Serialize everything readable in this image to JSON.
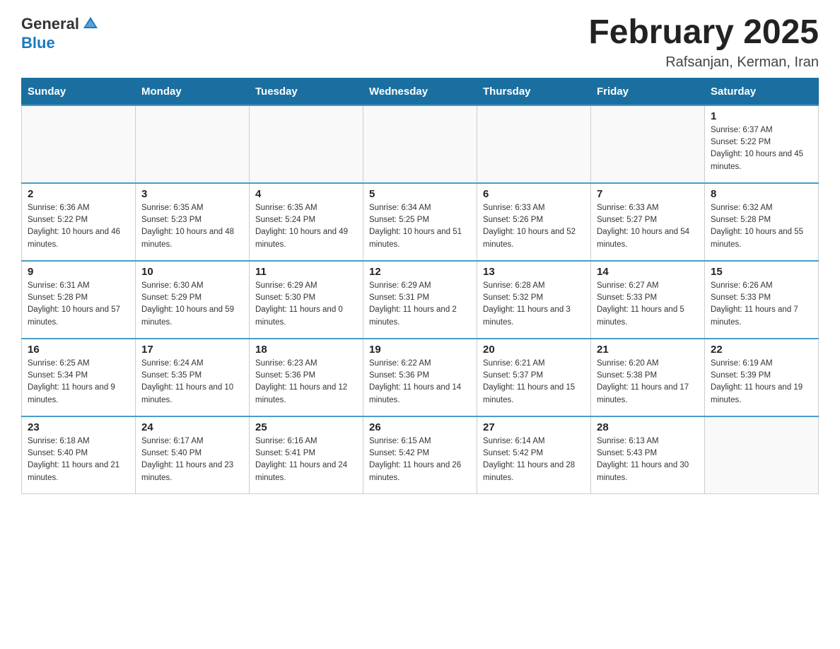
{
  "header": {
    "logo_general": "General",
    "logo_blue": "Blue",
    "title": "February 2025",
    "location": "Rafsanjan, Kerman, Iran"
  },
  "weekdays": [
    "Sunday",
    "Monday",
    "Tuesday",
    "Wednesday",
    "Thursday",
    "Friday",
    "Saturday"
  ],
  "weeks": [
    {
      "days": [
        {
          "number": "",
          "info": ""
        },
        {
          "number": "",
          "info": ""
        },
        {
          "number": "",
          "info": ""
        },
        {
          "number": "",
          "info": ""
        },
        {
          "number": "",
          "info": ""
        },
        {
          "number": "",
          "info": ""
        },
        {
          "number": "1",
          "info": "Sunrise: 6:37 AM\nSunset: 5:22 PM\nDaylight: 10 hours and 45 minutes."
        }
      ]
    },
    {
      "days": [
        {
          "number": "2",
          "info": "Sunrise: 6:36 AM\nSunset: 5:22 PM\nDaylight: 10 hours and 46 minutes."
        },
        {
          "number": "3",
          "info": "Sunrise: 6:35 AM\nSunset: 5:23 PM\nDaylight: 10 hours and 48 minutes."
        },
        {
          "number": "4",
          "info": "Sunrise: 6:35 AM\nSunset: 5:24 PM\nDaylight: 10 hours and 49 minutes."
        },
        {
          "number": "5",
          "info": "Sunrise: 6:34 AM\nSunset: 5:25 PM\nDaylight: 10 hours and 51 minutes."
        },
        {
          "number": "6",
          "info": "Sunrise: 6:33 AM\nSunset: 5:26 PM\nDaylight: 10 hours and 52 minutes."
        },
        {
          "number": "7",
          "info": "Sunrise: 6:33 AM\nSunset: 5:27 PM\nDaylight: 10 hours and 54 minutes."
        },
        {
          "number": "8",
          "info": "Sunrise: 6:32 AM\nSunset: 5:28 PM\nDaylight: 10 hours and 55 minutes."
        }
      ]
    },
    {
      "days": [
        {
          "number": "9",
          "info": "Sunrise: 6:31 AM\nSunset: 5:28 PM\nDaylight: 10 hours and 57 minutes."
        },
        {
          "number": "10",
          "info": "Sunrise: 6:30 AM\nSunset: 5:29 PM\nDaylight: 10 hours and 59 minutes."
        },
        {
          "number": "11",
          "info": "Sunrise: 6:29 AM\nSunset: 5:30 PM\nDaylight: 11 hours and 0 minutes."
        },
        {
          "number": "12",
          "info": "Sunrise: 6:29 AM\nSunset: 5:31 PM\nDaylight: 11 hours and 2 minutes."
        },
        {
          "number": "13",
          "info": "Sunrise: 6:28 AM\nSunset: 5:32 PM\nDaylight: 11 hours and 3 minutes."
        },
        {
          "number": "14",
          "info": "Sunrise: 6:27 AM\nSunset: 5:33 PM\nDaylight: 11 hours and 5 minutes."
        },
        {
          "number": "15",
          "info": "Sunrise: 6:26 AM\nSunset: 5:33 PM\nDaylight: 11 hours and 7 minutes."
        }
      ]
    },
    {
      "days": [
        {
          "number": "16",
          "info": "Sunrise: 6:25 AM\nSunset: 5:34 PM\nDaylight: 11 hours and 9 minutes."
        },
        {
          "number": "17",
          "info": "Sunrise: 6:24 AM\nSunset: 5:35 PM\nDaylight: 11 hours and 10 minutes."
        },
        {
          "number": "18",
          "info": "Sunrise: 6:23 AM\nSunset: 5:36 PM\nDaylight: 11 hours and 12 minutes."
        },
        {
          "number": "19",
          "info": "Sunrise: 6:22 AM\nSunset: 5:36 PM\nDaylight: 11 hours and 14 minutes."
        },
        {
          "number": "20",
          "info": "Sunrise: 6:21 AM\nSunset: 5:37 PM\nDaylight: 11 hours and 15 minutes."
        },
        {
          "number": "21",
          "info": "Sunrise: 6:20 AM\nSunset: 5:38 PM\nDaylight: 11 hours and 17 minutes."
        },
        {
          "number": "22",
          "info": "Sunrise: 6:19 AM\nSunset: 5:39 PM\nDaylight: 11 hours and 19 minutes."
        }
      ]
    },
    {
      "days": [
        {
          "number": "23",
          "info": "Sunrise: 6:18 AM\nSunset: 5:40 PM\nDaylight: 11 hours and 21 minutes."
        },
        {
          "number": "24",
          "info": "Sunrise: 6:17 AM\nSunset: 5:40 PM\nDaylight: 11 hours and 23 minutes."
        },
        {
          "number": "25",
          "info": "Sunrise: 6:16 AM\nSunset: 5:41 PM\nDaylight: 11 hours and 24 minutes."
        },
        {
          "number": "26",
          "info": "Sunrise: 6:15 AM\nSunset: 5:42 PM\nDaylight: 11 hours and 26 minutes."
        },
        {
          "number": "27",
          "info": "Sunrise: 6:14 AM\nSunset: 5:42 PM\nDaylight: 11 hours and 28 minutes."
        },
        {
          "number": "28",
          "info": "Sunrise: 6:13 AM\nSunset: 5:43 PM\nDaylight: 11 hours and 30 minutes."
        },
        {
          "number": "",
          "info": ""
        }
      ]
    }
  ]
}
